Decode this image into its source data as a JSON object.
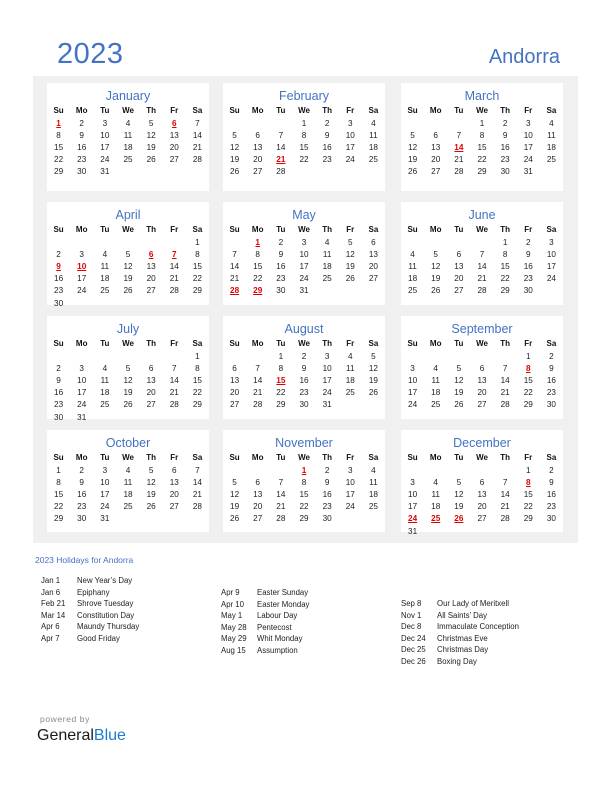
{
  "header": {
    "year": "2023",
    "country": "Andorra"
  },
  "weekdays": [
    "Su",
    "Mo",
    "Tu",
    "We",
    "Th",
    "Fr",
    "Sa"
  ],
  "colors": {
    "accent": "#4472c4",
    "holiday": "#e00000",
    "panel": "#f0f0f0",
    "brand_blue": "#1c7cd5"
  },
  "months": [
    {
      "name": "January",
      "start": 0,
      "days": 31,
      "holidays": [
        1,
        6
      ]
    },
    {
      "name": "February",
      "start": 3,
      "days": 28,
      "holidays": [
        21
      ]
    },
    {
      "name": "March",
      "start": 3,
      "days": 31,
      "holidays": [
        14
      ]
    },
    {
      "name": "April",
      "start": 6,
      "days": 30,
      "holidays": [
        6,
        7,
        9,
        10
      ]
    },
    {
      "name": "May",
      "start": 1,
      "days": 31,
      "holidays": [
        1,
        28,
        29
      ]
    },
    {
      "name": "June",
      "start": 4,
      "days": 30,
      "holidays": []
    },
    {
      "name": "July",
      "start": 6,
      "days": 31,
      "holidays": []
    },
    {
      "name": "August",
      "start": 2,
      "days": 31,
      "holidays": [
        15
      ]
    },
    {
      "name": "September",
      "start": 5,
      "days": 30,
      "holidays": [
        8
      ]
    },
    {
      "name": "October",
      "start": 0,
      "days": 31,
      "holidays": []
    },
    {
      "name": "November",
      "start": 3,
      "days": 30,
      "holidays": [
        1
      ]
    },
    {
      "name": "December",
      "start": 5,
      "days": 31,
      "holidays": [
        8,
        24,
        25,
        26
      ]
    }
  ],
  "holidays_section": {
    "title": "2023 Holidays for Andorra",
    "columns": [
      [
        {
          "date": "Jan 1",
          "name": "New Year’s Day"
        },
        {
          "date": "Jan 6",
          "name": "Epiphany"
        },
        {
          "date": "Feb 21",
          "name": "Shrove Tuesday"
        },
        {
          "date": "Mar 14",
          "name": "Constitution Day"
        },
        {
          "date": "Apr 6",
          "name": "Maundy Thursday"
        },
        {
          "date": "Apr 7",
          "name": "Good Friday"
        }
      ],
      [
        {
          "date": "Apr 9",
          "name": "Easter Sunday"
        },
        {
          "date": "Apr 10",
          "name": "Easter Monday"
        },
        {
          "date": "May 1",
          "name": "Labour Day"
        },
        {
          "date": "May 28",
          "name": "Pentecost"
        },
        {
          "date": "May 29",
          "name": "Whit Monday"
        },
        {
          "date": "Aug 15",
          "name": "Assumption"
        }
      ],
      [
        {
          "date": "Sep 8",
          "name": "Our Lady of Meritxell"
        },
        {
          "date": "Nov 1",
          "name": "All Saints’ Day"
        },
        {
          "date": "Dec 8",
          "name": "Immaculate Conception"
        },
        {
          "date": "Dec 24",
          "name": "Christmas Eve"
        },
        {
          "date": "Dec 25",
          "name": "Christmas Day"
        },
        {
          "date": "Dec 26",
          "name": "Boxing Day"
        }
      ]
    ]
  },
  "footer": {
    "powered_by": "powered by",
    "brand_general": "General",
    "brand_blue": "Blue"
  }
}
